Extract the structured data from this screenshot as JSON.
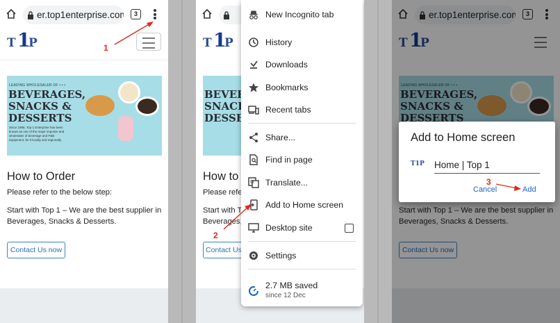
{
  "browser": {
    "url": "er.top1enterprise.com",
    "tab_count": "3"
  },
  "site": {
    "logo_text": "T1P",
    "banner": {
      "lead": "LEADING WHOLESALER OF • • •",
      "line1": "BEVERAGES,",
      "line2": "SNACKS &",
      "line3": "DESSERTS",
      "small": "Since 1996, Top 1 Enterprise has been known as one of the major importer and wholesaler of beverage and F&B equipment, be it locally and regionally."
    },
    "heading": "How to Order",
    "para1": "Please refer to the below step:",
    "para2_line1": "Start with Top 1 – We are the best supplier in",
    "para2_line2": "Beverages, Snacks & Desserts.",
    "contact_button": "Contact Us now",
    "heading_partial": "How to O",
    "para1_partial": "Please refer",
    "para2_partial_l1": "Start with To",
    "para2_partial_l2": "Beverages, S",
    "contact_partial": "Contact Us"
  },
  "menu": {
    "items": [
      {
        "label": "New Incognito tab",
        "icon": "incognito-icon"
      },
      {
        "label": "History",
        "icon": "history-icon"
      },
      {
        "label": "Downloads",
        "icon": "download-icon"
      },
      {
        "label": "Bookmarks",
        "icon": "star-icon"
      },
      {
        "label": "Recent tabs",
        "icon": "devices-icon"
      },
      {
        "label": "Share...",
        "icon": "share-icon"
      },
      {
        "label": "Find in page",
        "icon": "find-icon"
      },
      {
        "label": "Translate...",
        "icon": "translate-icon"
      },
      {
        "label": "Add to Home screen",
        "icon": "add-home-icon"
      },
      {
        "label": "Desktop site",
        "icon": "desktop-icon"
      },
      {
        "label": "Settings",
        "icon": "gear-icon"
      }
    ],
    "saved_amount": "2.7 MB saved",
    "saved_since": "since 12 Dec"
  },
  "dialog": {
    "title": "Add to Home screen",
    "name_value": "Home | Top 1",
    "cancel_label": "Cancel",
    "add_label": "Add"
  },
  "annotations": {
    "step1": "1",
    "step2": "2",
    "step3": "3",
    "color": "#e02818"
  }
}
